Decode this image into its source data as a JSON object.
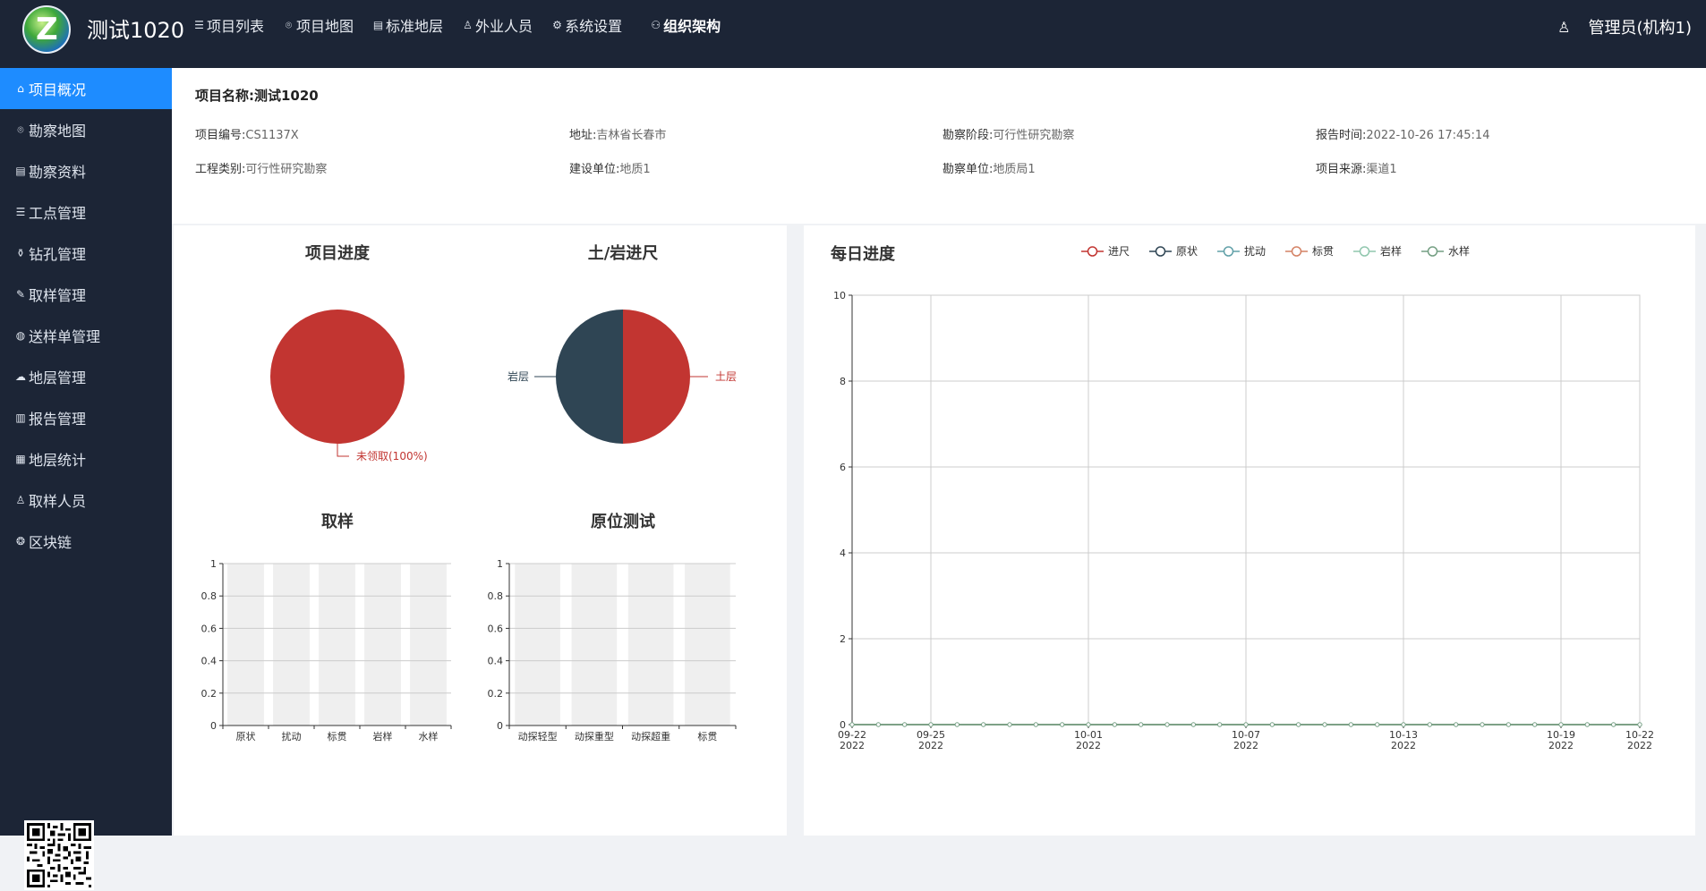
{
  "app": {
    "title": "测试1020"
  },
  "topnav": [
    {
      "label": "项目列表",
      "icon": "list-icon"
    },
    {
      "label": "项目地图",
      "icon": "map-pin-icon"
    },
    {
      "label": "标准地层",
      "icon": "layers-icon"
    },
    {
      "label": "外业人员",
      "icon": "user-icon"
    },
    {
      "label": "系统设置",
      "icon": "gear-icon"
    },
    {
      "label": "组织架构",
      "icon": "org-icon"
    }
  ],
  "user": {
    "label": "管理员(机构1)",
    "icon": "user-icon"
  },
  "sidebar": [
    {
      "label": "项目概况",
      "icon": "home-icon",
      "active": true
    },
    {
      "label": "勘察地图",
      "icon": "map-pin-icon"
    },
    {
      "label": "勘察资料",
      "icon": "document-icon"
    },
    {
      "label": "工点管理",
      "icon": "list-icon"
    },
    {
      "label": "钻孔管理",
      "icon": "drill-icon"
    },
    {
      "label": "取样管理",
      "icon": "pen-icon"
    },
    {
      "label": "送样单管理",
      "icon": "sample-icon"
    },
    {
      "label": "地层管理",
      "icon": "strata-icon"
    },
    {
      "label": "报告管理",
      "icon": "report-icon"
    },
    {
      "label": "地层统计",
      "icon": "stats-icon"
    },
    {
      "label": "取样人员",
      "icon": "people-icon"
    },
    {
      "label": "区块链",
      "icon": "blockchain-icon"
    }
  ],
  "project": {
    "name_label": "项目名称:",
    "name": "测试1020",
    "fields": [
      {
        "label": "项目编号:",
        "value": "CS1137X"
      },
      {
        "label": "地址:",
        "value": "吉林省长春市"
      },
      {
        "label": "勘察阶段:",
        "value": "可行性研究勘察"
      },
      {
        "label": "报告时间:",
        "value": "2022-10-26 17:45:14"
      },
      {
        "label": "工程类别:",
        "value": "可行性研究勘察"
      },
      {
        "label": "建设单位:",
        "value": "地质1"
      },
      {
        "label": "勘察单位:",
        "value": "地质局1"
      },
      {
        "label": "项目来源:",
        "value": "渠道1"
      }
    ]
  },
  "chart_data": [
    {
      "type": "pie",
      "title": "项目进度",
      "slices": [
        {
          "label": "未领取(100%)",
          "value": 100,
          "color": "#c23531"
        }
      ]
    },
    {
      "type": "pie",
      "title": "土/岩进尺",
      "slices": [
        {
          "label": "土层",
          "value": 50,
          "color": "#c23531"
        },
        {
          "label": "岩层",
          "value": 50,
          "color": "#2f4554"
        }
      ]
    },
    {
      "type": "bar",
      "title": "取样",
      "categories": [
        "原状",
        "扰动",
        "标贯",
        "岩样",
        "水样"
      ],
      "values": [
        0,
        0,
        0,
        0,
        0
      ],
      "ylim": [
        0,
        1
      ],
      "yticks": [
        "0",
        "0.2",
        "0.4",
        "0.6",
        "0.8",
        "1"
      ]
    },
    {
      "type": "bar",
      "title": "原位测试",
      "categories": [
        "动探轻型",
        "动探重型",
        "动探超重",
        "标贯"
      ],
      "values": [
        0,
        0,
        0,
        0
      ],
      "ylim": [
        0,
        1
      ],
      "yticks": [
        "0",
        "0.2",
        "0.4",
        "0.6",
        "0.8",
        "1"
      ]
    },
    {
      "type": "line",
      "title": "每日进度",
      "legend": [
        {
          "name": "进尺",
          "color": "#c23531"
        },
        {
          "name": "原状",
          "color": "#2f4554"
        },
        {
          "name": "扰动",
          "color": "#61a0a8"
        },
        {
          "name": "标贯",
          "color": "#d48265"
        },
        {
          "name": "岩样",
          "color": "#91c7ae"
        },
        {
          "name": "水样",
          "color": "#749f83"
        }
      ],
      "ylim": [
        0,
        10
      ],
      "yticks": [
        "0",
        "2",
        "4",
        "6",
        "8",
        "10"
      ],
      "xticks": [
        {
          "date": "09-22",
          "year": "2022"
        },
        {
          "date": "09-25",
          "year": "2022"
        },
        {
          "date": "10-01",
          "year": "2022"
        },
        {
          "date": "10-07",
          "year": "2022"
        },
        {
          "date": "10-13",
          "year": "2022"
        },
        {
          "date": "10-19",
          "year": "2022"
        },
        {
          "date": "10-22",
          "year": "2022"
        }
      ],
      "x_start": "2022-09-22",
      "x_end": "2022-10-22",
      "values_all": 0
    }
  ]
}
